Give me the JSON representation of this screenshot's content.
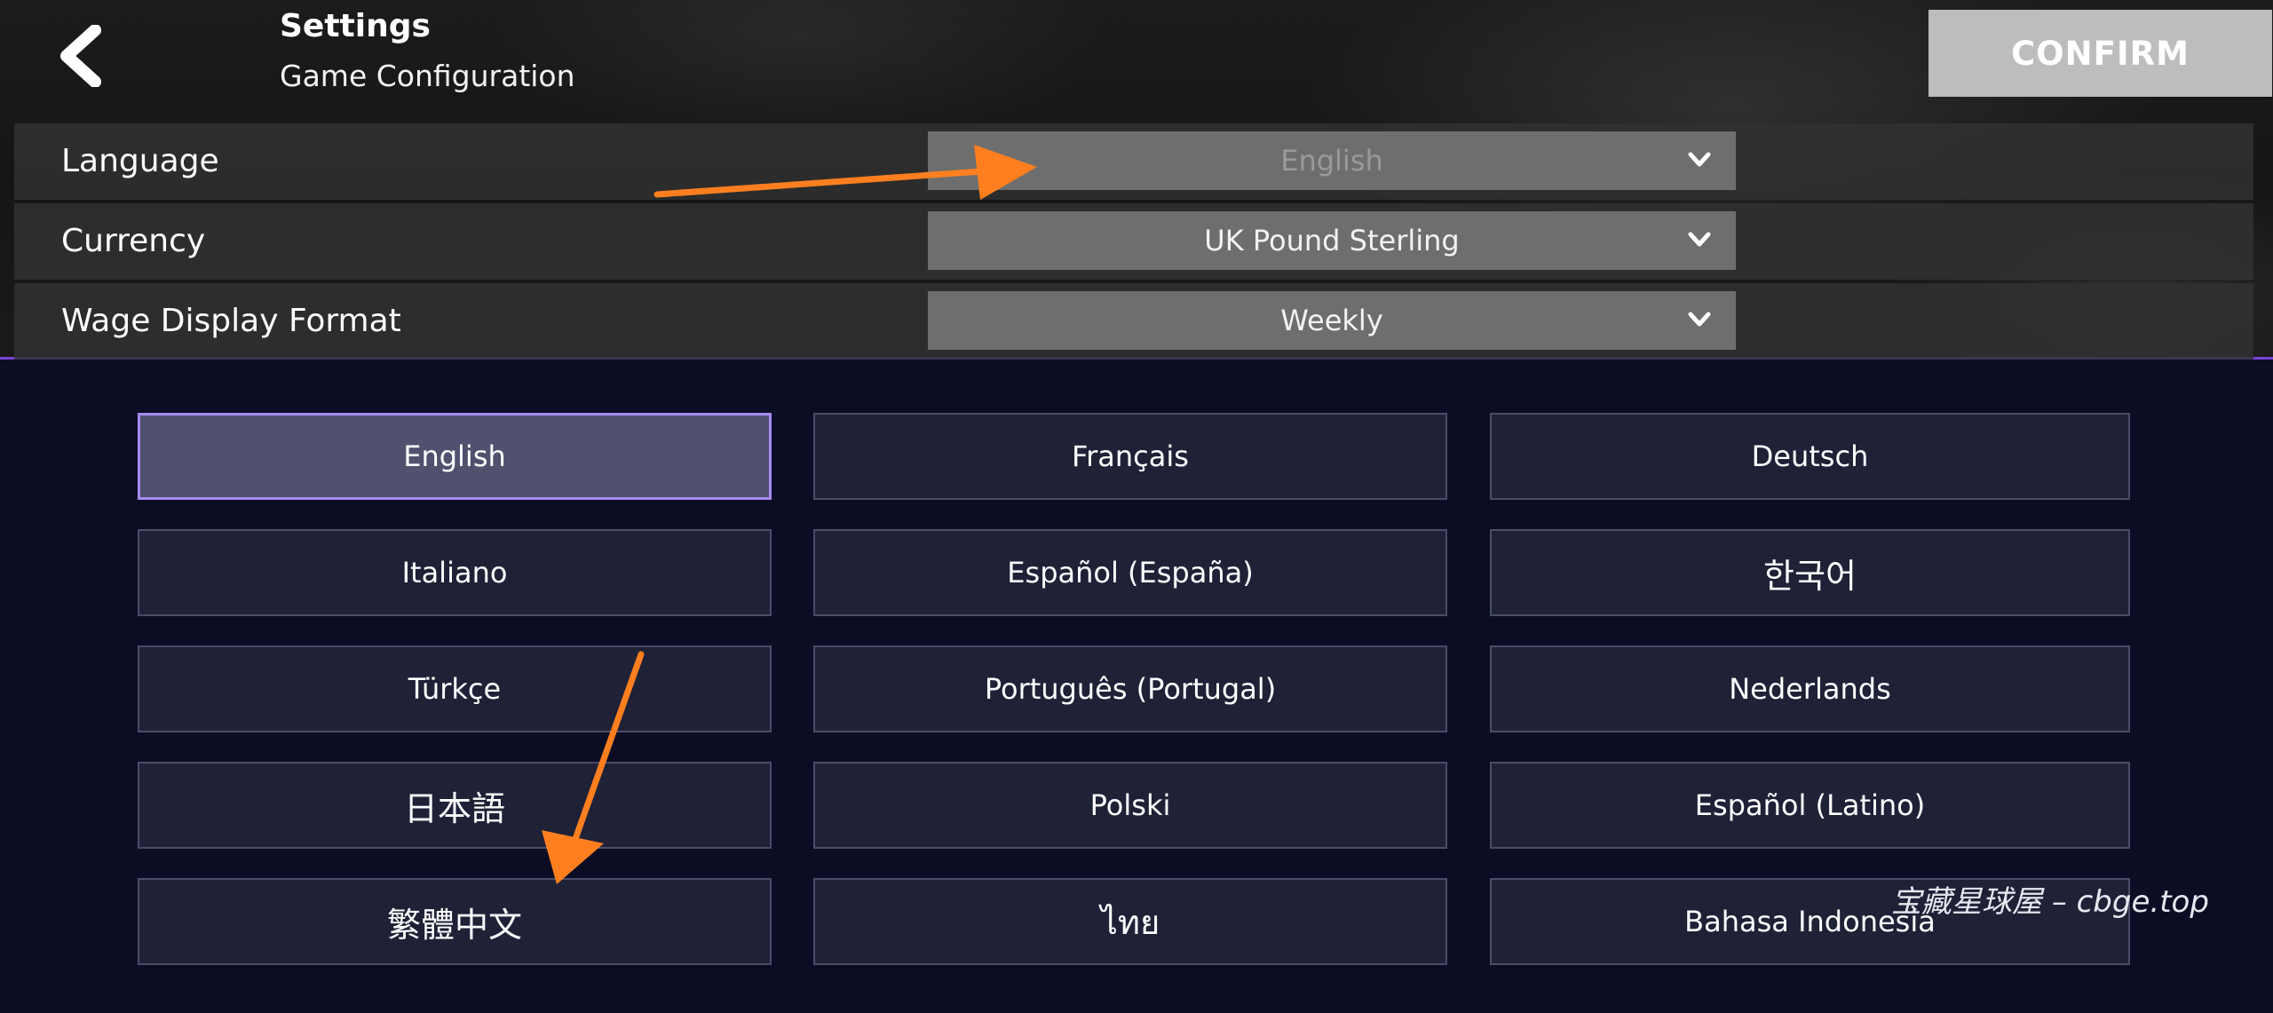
{
  "header": {
    "title": "Settings",
    "subtitle": "Game Configuration",
    "confirm_label": "CONFIRM",
    "back_icon": "chevron-left-icon"
  },
  "settings": [
    {
      "label": "Language",
      "value": "English",
      "muted": true
    },
    {
      "label": "Currency",
      "value": "UK Pound Sterling",
      "muted": false
    },
    {
      "label": "Wage Display Format",
      "value": "Weekly",
      "muted": false
    }
  ],
  "languages": [
    [
      "English",
      "Français",
      "Deutsch"
    ],
    [
      "Italiano",
      "Español (España)",
      "한국어"
    ],
    [
      "Türkçe",
      "Português (Portugal)",
      "Nederlands"
    ],
    [
      "日本語",
      "Polski",
      "Español (Latino)"
    ],
    [
      "繁體中文",
      "ไทย",
      "Bahasa Indonesia"
    ]
  ],
  "selected_language": "English",
  "watermark": "宝藏星球屋 – cbge.top",
  "colors": {
    "accent": "#7a43d6",
    "selected_border": "#a88af0",
    "annotation_arrow": "#ff7f1f",
    "confirm_bg": "#bdbdbd"
  }
}
